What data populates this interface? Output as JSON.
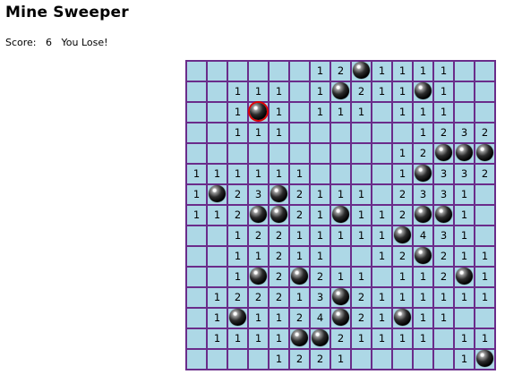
{
  "title": "Mine Sweeper",
  "status": {
    "score_label": "Score:",
    "score_value": "6",
    "message": "You Lose!"
  },
  "board": {
    "rows": [
      [
        "",
        "",
        "",
        "",
        "",
        "",
        "1",
        "2",
        "*",
        "1",
        "1",
        "1",
        "1",
        "",
        ""
      ],
      [
        "",
        "",
        "1",
        "1",
        "1",
        "",
        "1",
        "*",
        "2",
        "1",
        "1",
        "*",
        "1",
        "",
        ""
      ],
      [
        "",
        "",
        "1",
        "X",
        "1",
        "",
        "1",
        "1",
        "1",
        "",
        "1",
        "1",
        "1",
        "",
        ""
      ],
      [
        "",
        "",
        "1",
        "1",
        "1",
        "",
        "",
        "",
        "",
        "",
        "",
        "1",
        "2",
        "3",
        "2"
      ],
      [
        "",
        "",
        "",
        "",
        "",
        "",
        "",
        "",
        "",
        "",
        "1",
        "2",
        "*",
        "*",
        "*"
      ],
      [
        "1",
        "1",
        "1",
        "1",
        "1",
        "1",
        "",
        "",
        "",
        "",
        "1",
        "*",
        "3",
        "3",
        "2"
      ],
      [
        "1",
        "*",
        "2",
        "3",
        "*",
        "2",
        "1",
        "1",
        "1",
        "",
        "2",
        "3",
        "3",
        "1",
        ""
      ],
      [
        "1",
        "1",
        "2",
        "*",
        "*",
        "2",
        "1",
        "*",
        "1",
        "1",
        "2",
        "*",
        "*",
        "1",
        ""
      ],
      [
        "",
        "",
        "1",
        "2",
        "2",
        "1",
        "1",
        "1",
        "1",
        "1",
        "*",
        "4",
        "3",
        "1",
        ""
      ],
      [
        "",
        "",
        "1",
        "1",
        "2",
        "1",
        "1",
        "",
        "",
        "1",
        "2",
        "*",
        "2",
        "1",
        "1"
      ],
      [
        "",
        "",
        "1",
        "*",
        "2",
        "*",
        "2",
        "1",
        "1",
        "",
        "1",
        "1",
        "2",
        "*",
        "1"
      ],
      [
        "",
        "1",
        "2",
        "2",
        "2",
        "1",
        "3",
        "*",
        "2",
        "1",
        "1",
        "1",
        "1",
        "1",
        "1"
      ],
      [
        "",
        "1",
        "*",
        "1",
        "1",
        "2",
        "4",
        "*",
        "2",
        "1",
        "*",
        "1",
        "1",
        "",
        ""
      ],
      [
        "",
        "1",
        "1",
        "1",
        "1",
        "*",
        "*",
        "2",
        "1",
        "1",
        "1",
        "1",
        "",
        "1",
        "1"
      ],
      [
        "",
        "",
        "",
        "",
        "1",
        "2",
        "2",
        "1",
        "",
        "",
        "",
        "",
        "",
        "1",
        "*"
      ]
    ]
  }
}
